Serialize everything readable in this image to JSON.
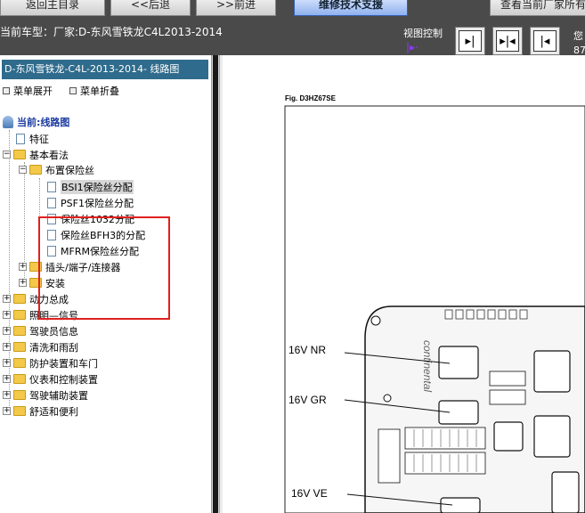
{
  "toolbar": {
    "home_label": "返回主目录",
    "back_label": "<<后退",
    "forward_label": ">>前进",
    "tech_label": "维修技术支援",
    "right_label": "查看当前厂家所有"
  },
  "status": {
    "model_line": "当前车型：厂家:D-东风雪铁龙C4L2013-2014",
    "view_control": "视图控制",
    "view_icon": "|▸·",
    "right_cut": "您\n87"
  },
  "view_buttons": [
    {
      "icon": "expand-right-icon",
      "glyph": "▸|"
    },
    {
      "icon": "split-center-icon",
      "glyph": "▸|◂"
    },
    {
      "icon": "collapse-left-icon",
      "glyph": "|◂"
    }
  ],
  "left_panel": {
    "title": "D-东风雪铁龙-C4L-2013-2014- 线路图",
    "menu_expand": "菜单展开",
    "menu_collapse": "菜单折叠"
  },
  "tree": {
    "root": "当前:线路图",
    "items": [
      {
        "label": "特征"
      },
      {
        "label": "基本看法"
      },
      {
        "label": "布置保险丝"
      },
      {
        "label": "BSI1保险丝分配"
      },
      {
        "label": "PSF1保险丝分配"
      },
      {
        "label": "保险丝1032分配"
      },
      {
        "label": "保险丝BFH3的分配"
      },
      {
        "label": "MFRM保险丝分配"
      },
      {
        "label": "插头/端子/连接器"
      },
      {
        "label": "安装"
      },
      {
        "label": "动力总成"
      },
      {
        "label": "照明—信号"
      },
      {
        "label": "驾驶员信息"
      },
      {
        "label": "清洗和雨刮"
      },
      {
        "label": "防护装置和车门"
      },
      {
        "label": "仪表和控制装置"
      },
      {
        "label": "驾驶辅助装置"
      },
      {
        "label": "舒适和便利"
      }
    ]
  },
  "diagram": {
    "fig_label": "Fig. D3HZ67SE",
    "labels": [
      "16V NR",
      "16V GR",
      "16V VE"
    ],
    "board_text": "continental"
  }
}
